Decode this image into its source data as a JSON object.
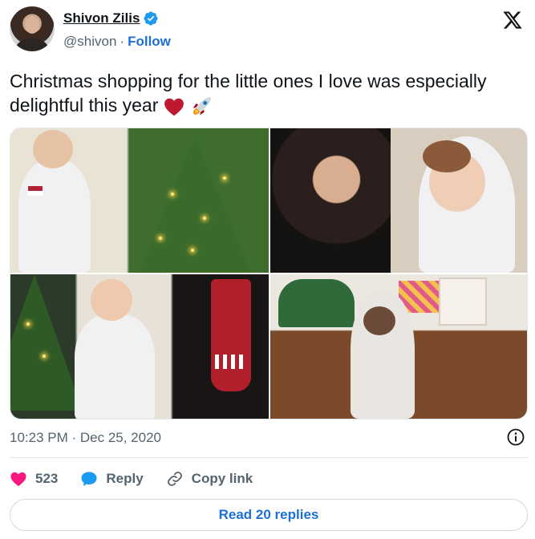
{
  "author": {
    "name": "Shivon Zilis",
    "handle": "@shivon",
    "separator": "·",
    "follow_label": "Follow"
  },
  "tweet": {
    "text": "Christmas shopping for the little ones I love was especially delightful this year",
    "emojis": [
      "red-heart",
      "rocket"
    ]
  },
  "photos": [
    {
      "name": "photo-toddler-by-tree"
    },
    {
      "name": "photo-mother-and-child"
    },
    {
      "name": "photo-boy-in-spacesuit"
    },
    {
      "name": "photo-toddler-in-hood"
    }
  ],
  "meta": {
    "timestamp": "10:23 PM · Dec 25, 2020"
  },
  "actions": {
    "likes": "523",
    "reply_label": "Reply",
    "copy_link_label": "Copy link"
  },
  "footer": {
    "read_replies_label": "Read 20 replies"
  },
  "colors": {
    "accent": "#1d6fd6",
    "like": "#f91880",
    "reply_icon": "#1d9bf0",
    "text": "#0f1419",
    "muted": "#536471"
  }
}
